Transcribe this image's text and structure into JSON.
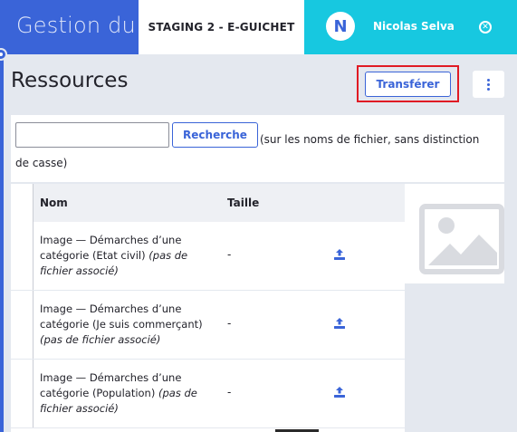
{
  "header": {
    "app_title": "Gestion du portail",
    "environment": "STAGING 2 - E-GUICHET",
    "user": {
      "initial": "N",
      "name": "Nicolas Selva"
    }
  },
  "page": {
    "title": "Ressources",
    "transfer_label": "Transférer"
  },
  "search": {
    "input_value": "",
    "button_label": "Recherche",
    "hint": "(sur les noms de fichier, sans distinction de casse)"
  },
  "table": {
    "columns": [
      "Nom",
      "Taille"
    ],
    "rows": [
      {
        "name": "Image — Démarches d’une catégorie (Etat civil) ",
        "note": "(pas de fichier associé)",
        "size": "-"
      },
      {
        "name": "Image — Démarches d’une catégorie (Je suis commerçant) ",
        "note": "(pas de fichier associé)",
        "size": "-"
      },
      {
        "name": "Image — Démarches d’une catégorie (Population) ",
        "note": "(pas de fichier associé)",
        "size": "-"
      }
    ]
  },
  "colors": {
    "primary": "#3a64d8",
    "accent_cyan": "#17c8e0",
    "highlight_red": "#e01b24",
    "background": "#e4e8ef"
  },
  "icons": {
    "upload": "upload-icon",
    "more": "kebab-menu-icon",
    "close": "close-circle-icon",
    "placeholder": "image-placeholder-icon"
  }
}
